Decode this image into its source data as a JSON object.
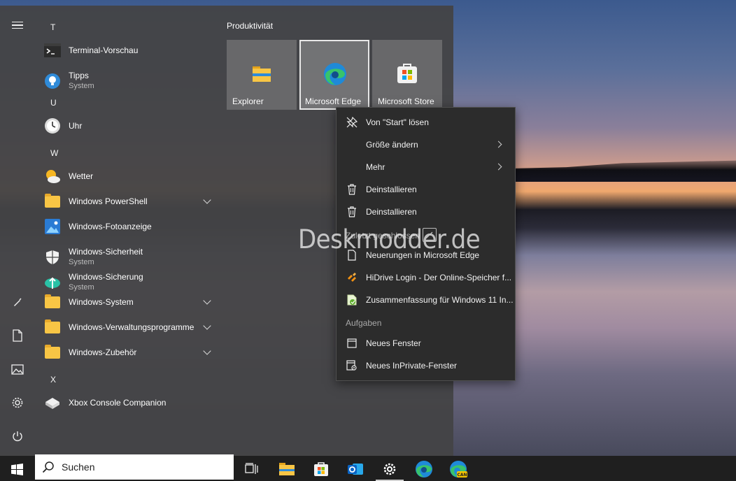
{
  "start_menu": {
    "letters": [
      "T",
      "U",
      "W",
      "X"
    ],
    "apps": [
      {
        "name": "Terminal-Vorschau",
        "sub": "",
        "icon": "terminal-icon",
        "has_chevron": false
      },
      {
        "name": "Tipps",
        "sub": "System",
        "icon": "tips-icon",
        "has_chevron": false
      },
      {
        "name": "Uhr",
        "sub": "",
        "icon": "clock-icon",
        "has_chevron": false
      },
      {
        "name": "Wetter",
        "sub": "",
        "icon": "weather-icon",
        "has_chevron": false
      },
      {
        "name": "Windows PowerShell",
        "sub": "",
        "icon": "folder-icon",
        "has_chevron": true
      },
      {
        "name": "Windows-Fotoanzeige",
        "sub": "",
        "icon": "photo-viewer-icon",
        "has_chevron": false
      },
      {
        "name": "Windows-Sicherheit",
        "sub": "System",
        "icon": "shield-icon",
        "has_chevron": false
      },
      {
        "name": "Windows-Sicherung",
        "sub": "System",
        "icon": "backup-icon",
        "has_chevron": false
      },
      {
        "name": "Windows-System",
        "sub": "",
        "icon": "folder-icon",
        "has_chevron": true
      },
      {
        "name": "Windows-Verwaltungsprogramme",
        "sub": "",
        "icon": "folder-icon",
        "has_chevron": true
      },
      {
        "name": "Windows-Zubehör",
        "sub": "",
        "icon": "folder-icon",
        "has_chevron": true
      },
      {
        "name": "Xbox Console Companion",
        "sub": "",
        "icon": "xbox-icon",
        "has_chevron": false
      }
    ],
    "group_title": "Produktivität",
    "tiles": [
      {
        "label": "Explorer",
        "icon": "file-explorer-icon",
        "selected": false
      },
      {
        "label": "Microsoft Edge",
        "icon": "edge-icon",
        "selected": true
      },
      {
        "label": "Microsoft Store",
        "icon": "store-icon",
        "selected": false
      }
    ],
    "rail_icons": [
      "menu-icon",
      "pen-icon",
      "document-icon",
      "pictures-icon",
      "settings-icon",
      "power-icon"
    ]
  },
  "context_menu": {
    "items": [
      {
        "label": "Von \"Start\" lösen",
        "icon": "unpin-icon",
        "submenu": false
      },
      {
        "label": "Größe ändern",
        "icon": "",
        "submenu": true
      },
      {
        "label": "Mehr",
        "icon": "",
        "submenu": true
      },
      {
        "label": "Deinstallieren",
        "icon": "trash-icon",
        "submenu": false
      },
      {
        "label": "Deinstallieren",
        "icon": "trash-icon",
        "submenu": false
      }
    ],
    "recent_header": "Zuletzt geschlossen",
    "recent": [
      {
        "label": "Neuerungen in Microsoft Edge",
        "icon": "page-icon"
      },
      {
        "label": "HiDrive Login - Der Online-Speicher f...",
        "icon": "hidrive-icon"
      },
      {
        "label": "Zusammenfassung für Windows 11 In...",
        "icon": "site-favicon-icon"
      }
    ],
    "tasks_header": "Aufgaben",
    "tasks": [
      {
        "label": "Neues Fenster",
        "icon": "window-icon"
      },
      {
        "label": "Neues InPrivate-Fenster",
        "icon": "inprivate-icon"
      }
    ]
  },
  "watermark": "Deskmodder.de",
  "taskbar": {
    "search_placeholder": "Suchen",
    "icons": [
      "start-icon",
      "task-view-icon",
      "file-explorer-icon",
      "store-icon",
      "outlook-icon",
      "settings-icon",
      "edge-icon",
      "edge-canary-icon"
    ],
    "active": "settings-icon",
    "canary_badge": "CAN"
  }
}
